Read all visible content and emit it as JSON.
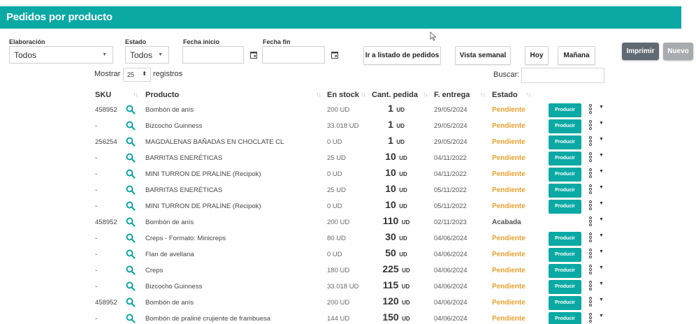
{
  "header": {
    "title": "Pedidos por producto"
  },
  "filters": {
    "elaboracion": {
      "label": "Elaboración",
      "value": "Todos"
    },
    "estado": {
      "label": "Estado",
      "value": "Todos"
    },
    "fecha_inicio": {
      "label": "Fecha inicio"
    },
    "fecha_fin": {
      "label": "Fecha fin"
    }
  },
  "toolbar": {
    "ir_listado": "Ir a listado de pedidos",
    "vista_semanal": "Vista semanal",
    "hoy": "Hoy",
    "manana": "Mañana",
    "imprimir": "Imprimir",
    "nuevo": "Nuevo"
  },
  "table_controls": {
    "show_prefix": "Mostrar",
    "page_size": "25",
    "show_suffix": "registros",
    "search_label": "Buscar:"
  },
  "columns": {
    "sku": "SKU",
    "producto": "Producto",
    "en_stock": "En stock",
    "cant_pedida": "Cant. pedida",
    "f_entrega": "F. entrega",
    "estado": "Estado"
  },
  "unit": "UD",
  "produce_label": "Producir",
  "colors": {
    "accent": "#0aa9a4",
    "pending": "#e8a030",
    "done": "#555555"
  },
  "rows": [
    {
      "sku": "458952",
      "producto": "Bombón de anís",
      "stock": "200 UD",
      "qty": "1",
      "date": "29/05/2024",
      "status": "Pendiente",
      "pending": true
    },
    {
      "sku": "-",
      "producto": "Bizcocho Guinness",
      "stock": "33.018 UD",
      "qty": "1",
      "date": "29/05/2024",
      "status": "Pendiente",
      "pending": true
    },
    {
      "sku": "256254",
      "producto": "MAGDALENAS BAÑADAS EN CHOCLATE CL",
      "stock": "0 UD",
      "qty": "1",
      "date": "29/05/2024",
      "status": "Pendiente",
      "pending": true
    },
    {
      "sku": "-",
      "producto": "BARRITAS ENERÉTICAS",
      "stock": "25 UD",
      "qty": "10",
      "date": "04/11/2022",
      "status": "Pendiente",
      "pending": true
    },
    {
      "sku": "-",
      "producto": "MINI TURRON DE PRALINE (Recipok)",
      "stock": "0 UD",
      "qty": "10",
      "date": "04/11/2022",
      "status": "Pendiente",
      "pending": true
    },
    {
      "sku": "-",
      "producto": "BARRITAS ENERÉTICAS",
      "stock": "25 UD",
      "qty": "10",
      "date": "05/11/2022",
      "status": "Pendiente",
      "pending": true
    },
    {
      "sku": "-",
      "producto": "MINI TURRON DE PRALINE (Recipok)",
      "stock": "0 UD",
      "qty": "10",
      "date": "05/11/2022",
      "status": "Pendiente",
      "pending": true
    },
    {
      "sku": "458952",
      "producto": "Bombón de anís",
      "stock": "200 UD",
      "qty": "110",
      "date": "02/11/2023",
      "status": "Acabada",
      "pending": false
    },
    {
      "sku": "-",
      "producto": "Creps - Formato: Minicreps",
      "stock": "80 UD",
      "qty": "30",
      "date": "04/06/2024",
      "status": "Pendiente",
      "pending": true
    },
    {
      "sku": "-",
      "producto": "Flan de avellana",
      "stock": "0 UD",
      "qty": "50",
      "date": "04/06/2024",
      "status": "Pendiente",
      "pending": true
    },
    {
      "sku": "-",
      "producto": "Creps",
      "stock": "180 UD",
      "qty": "225",
      "date": "04/06/2024",
      "status": "Pendiente",
      "pending": true
    },
    {
      "sku": "-",
      "producto": "Bizcocho Guinness",
      "stock": "33.018 UD",
      "qty": "115",
      "date": "04/06/2024",
      "status": "Pendiente",
      "pending": true
    },
    {
      "sku": "458952",
      "producto": "Bombón de anís",
      "stock": "200 UD",
      "qty": "120",
      "date": "04/06/2024",
      "status": "Pendiente",
      "pending": true
    },
    {
      "sku": "-",
      "producto": "Bombón de praliné crujiente de frambuesa",
      "stock": "144 UD",
      "qty": "150",
      "date": "04/06/2024",
      "status": "Pendiente",
      "pending": true
    }
  ]
}
